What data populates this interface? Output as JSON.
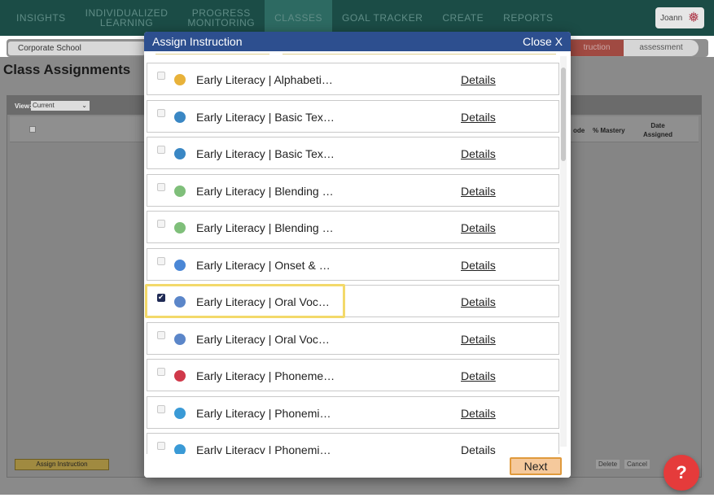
{
  "nav": {
    "items": [
      "INSIGHTS",
      "INDIVIDUALIZED\nLEARNING",
      "PROGRESS\nMONITORING",
      "CLASSES",
      "GOAL TRACKER",
      "CREATE",
      "REPORTS"
    ],
    "active_index": 3,
    "user_name": "Joann"
  },
  "subnav": {
    "school": "Corporate School",
    "instruction_tab": "truction",
    "assessment_tab": "assessment"
  },
  "page": {
    "title": "Class Assignments",
    "view_label": "View:",
    "view_value": "Current",
    "columns": {
      "code": "ode",
      "mastery": "% Mastery",
      "date": "Date Assigned"
    },
    "assign_button": "Assign Instruction",
    "delete_button": "Delete",
    "cancel_button": "Cancel",
    "help_label": "?"
  },
  "modal": {
    "title": "Assign Instruction",
    "close_label": "Close X",
    "details_label": "Details",
    "next_label": "Next",
    "items": [
      {
        "label": "Early Literacy | Alphabeti…",
        "checked": false,
        "icon_color": "#e8b23a",
        "icon_name": "circle-outline-icon"
      },
      {
        "label": "Early Literacy | Basic Tex…",
        "checked": false,
        "icon_color": "#3a87c4",
        "icon_name": "square-badge-icon"
      },
      {
        "label": "Early Literacy | Basic Tex…",
        "checked": false,
        "icon_color": "#3a87c4",
        "icon_name": "square-badge-icon"
      },
      {
        "label": "Early Literacy | Blending …",
        "checked": false,
        "icon_color": "#7fbf7a",
        "icon_name": "pill-icon"
      },
      {
        "label": "Early Literacy | Blending …",
        "checked": false,
        "icon_color": "#7fbf7a",
        "icon_name": "pill-icon"
      },
      {
        "label": "Early Literacy | Onset & …",
        "checked": false,
        "icon_color": "#4a87d6",
        "icon_name": "drop-icon"
      },
      {
        "label": "Early Literacy | Oral Voc…",
        "checked": true,
        "icon_color": "#5b86c9",
        "icon_name": "triangle-badge-icon"
      },
      {
        "label": "Early Literacy | Oral Voc…",
        "checked": false,
        "icon_color": "#5b86c9",
        "icon_name": "triangle-badge-icon"
      },
      {
        "label": "Early Literacy | Phoneme…",
        "checked": false,
        "icon_color": "#d0394a",
        "icon_name": "star-badge-icon"
      },
      {
        "label": "Early Literacy | Phonemi…",
        "checked": false,
        "icon_color": "#3a9ad6",
        "icon_name": "star-badge-icon"
      },
      {
        "label": "Early Literacy | Phonemi…",
        "checked": false,
        "icon_color": "#3a9ad6",
        "icon_name": "star-badge-icon"
      }
    ]
  },
  "colors": {
    "nav_bg": "#1b4c46",
    "modal_header": "#2d4f8f",
    "highlight": "#f3d96a",
    "next_border": "#e09a3d",
    "help_button": "#e53b3b"
  }
}
